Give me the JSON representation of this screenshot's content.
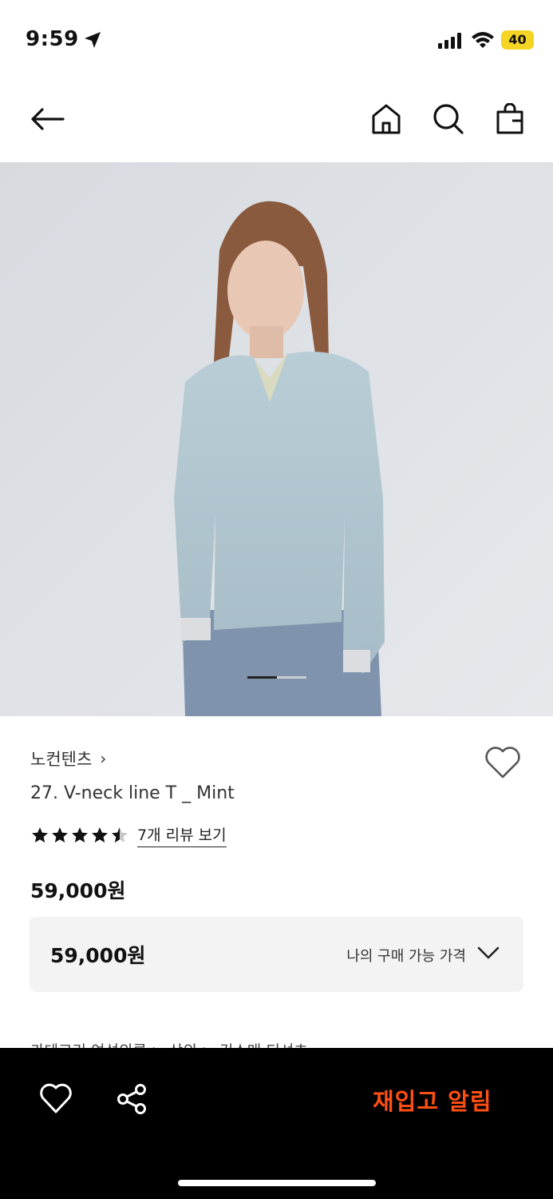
{
  "status_bar": {
    "time": "9:59",
    "battery": "40",
    "icons": [
      "location-arrow-icon",
      "signal-icon",
      "wifi-icon",
      "battery-icon"
    ]
  },
  "nav": {
    "icons": [
      "back-arrow-icon",
      "home-icon",
      "search-icon",
      "shopping-bag-icon"
    ]
  },
  "gallery": {
    "current_page": 1,
    "total_pages": 2
  },
  "product": {
    "brand": "노컨텐츠",
    "brand_chevron": "›",
    "name": "27. V-neck line T _ Mint",
    "rating": 4.5,
    "review_link": "7개 리뷰 보기",
    "price": "59,000원",
    "price_box": {
      "value": "59,000원",
      "label": "나의 구매 가능 가격"
    },
    "category_row": "카테고리        여성의류  >  상의  >  긴소매 티셔츠"
  },
  "bottom_bar": {
    "restock_label": "재입고 알림",
    "icons": [
      "heart-outline-icon",
      "share-icon"
    ]
  },
  "colors": {
    "accent": "#ff4f12",
    "background": "#ffffff",
    "bottom_bar": "#000000"
  }
}
